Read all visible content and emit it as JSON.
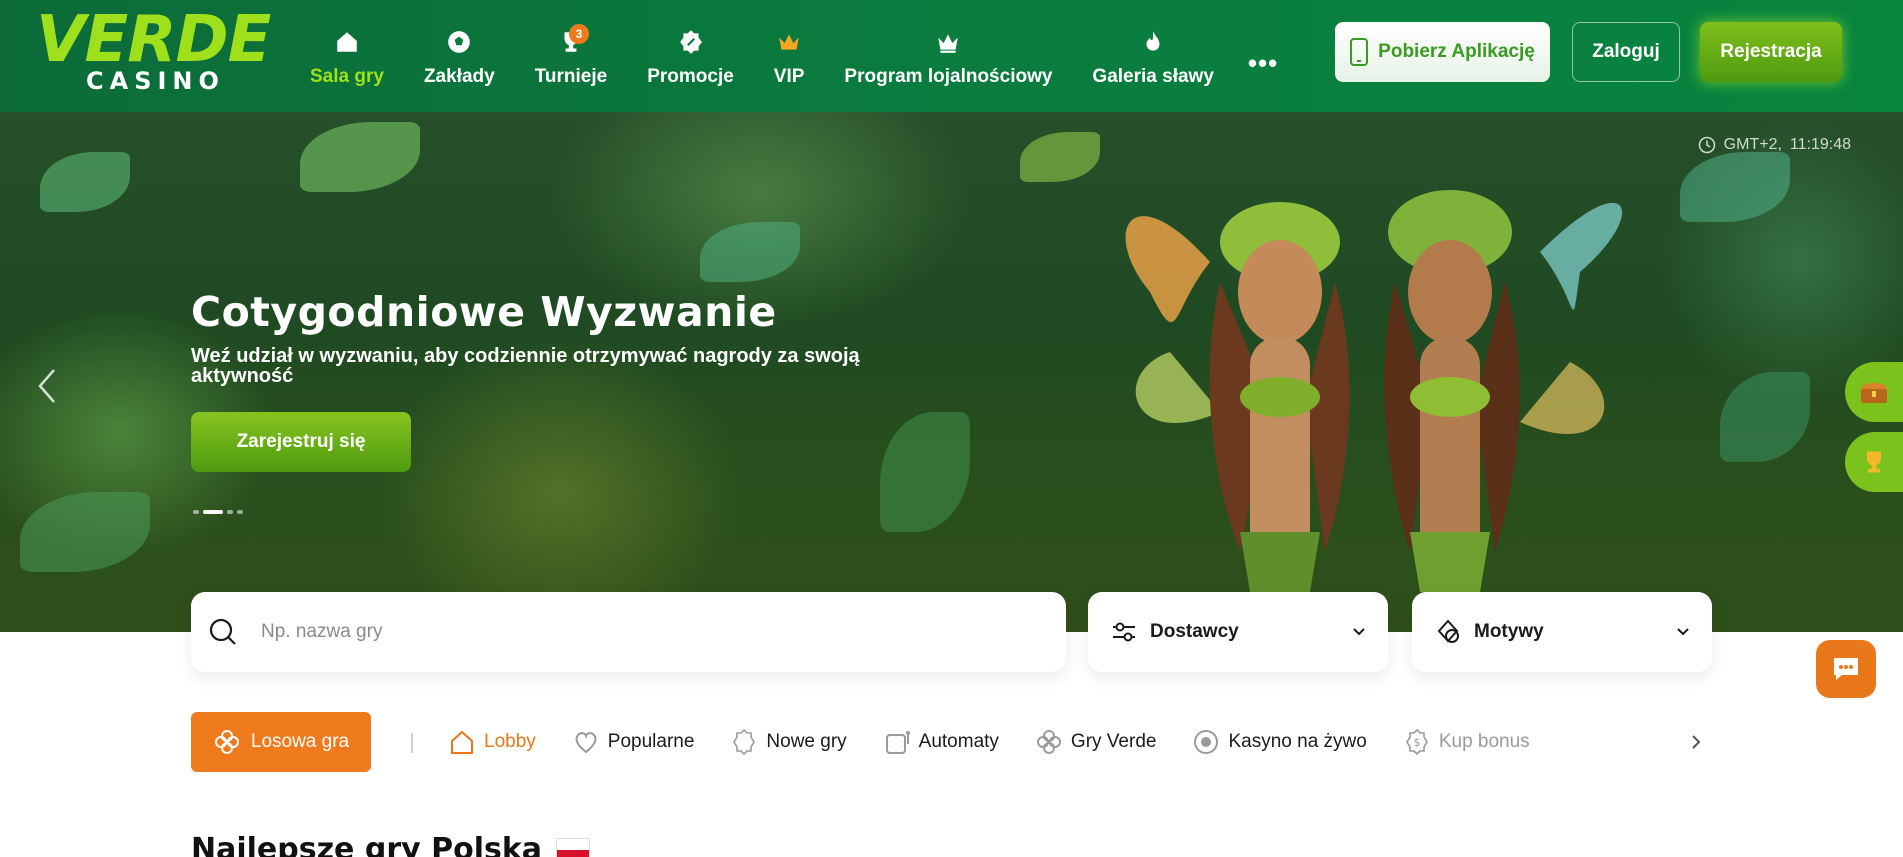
{
  "brand": {
    "logo_top": "VERDE",
    "logo_bottom": "CASINO"
  },
  "nav": {
    "items": [
      {
        "label": "Sala gry",
        "icon": "home-icon",
        "active": true
      },
      {
        "label": "Zakłady",
        "icon": "soccer-ball-icon"
      },
      {
        "label": "Turnieje",
        "icon": "trophy-icon",
        "badge": "3"
      },
      {
        "label": "Promocje",
        "icon": "discount-badge-icon"
      },
      {
        "label": "VIP",
        "icon": "crown-icon"
      },
      {
        "label": "Program lojalnościowy",
        "icon": "crown-outline-icon"
      },
      {
        "label": "Galeria sławy",
        "icon": "flame-icon"
      }
    ],
    "more": "•••"
  },
  "header_buttons": {
    "app_label": "Pobierz Aplikację",
    "login_label": "Zaloguj",
    "register_label": "Rejestracja"
  },
  "hero": {
    "time_zone": "GMT+2,",
    "time": "11:19:48",
    "title": "Cotygodniowe Wyzwanie",
    "subtitle": "Weź udział w wyzwaniu, aby codziennie otrzymywać nagrody za swoją aktywność",
    "cta_label": "Zarejestruj się",
    "slide_count": 4,
    "active_slide": 1
  },
  "search": {
    "placeholder": "Np. nazwa gry",
    "providers_label": "Dostawcy",
    "themes_label": "Motywy"
  },
  "categories": {
    "random_label": "Losowa gra",
    "items": [
      {
        "label": "Lobby",
        "icon": "home-outline-icon",
        "active": true
      },
      {
        "label": "Popularne",
        "icon": "heart-icon"
      },
      {
        "label": "Nowe gry",
        "icon": "new-badge-icon"
      },
      {
        "label": "Automaty",
        "icon": "slot-machine-icon"
      },
      {
        "label": "Gry Verde",
        "icon": "clover-icon"
      },
      {
        "label": "Kasyno na żywo",
        "icon": "live-dot-icon"
      },
      {
        "label": "Kup bonus",
        "icon": "coin-icon",
        "faded": true
      }
    ]
  },
  "section": {
    "title": "Najlepsze gry Polska"
  },
  "colors": {
    "header_green": "#0a7c3e",
    "accent_lime": "#9ee01c",
    "accent_orange": "#ef7a1b"
  }
}
